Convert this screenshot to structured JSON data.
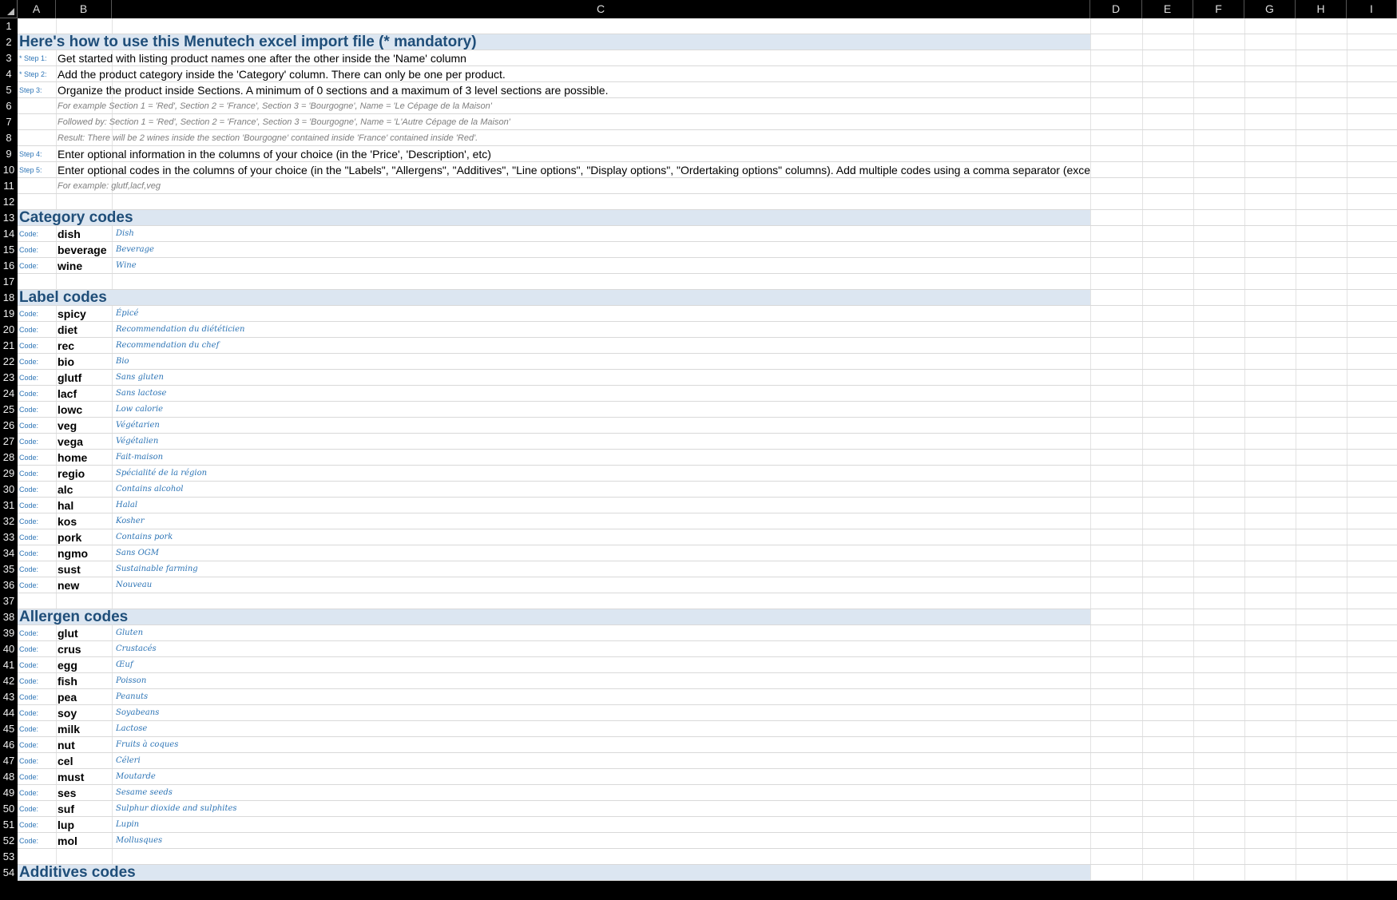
{
  "columns": [
    "A",
    "B",
    "C",
    "D",
    "E",
    "F",
    "G",
    "H",
    "I"
  ],
  "instructions": {
    "title": "Here's how to use this Menutech excel import file (* mandatory)",
    "steps": [
      {
        "label": "* Step 1:",
        "text": "Get started with listing product names one after the other inside the 'Name' column"
      },
      {
        "label": "* Step 2:",
        "text": "Add the product category inside the 'Category' column. There can only be one per product."
      },
      {
        "label": "Step 3:",
        "text": "Organize the product inside Sections. A minimum of 0 sections and a maximum of 3 level sections are possible."
      },
      {
        "label": "",
        "example": "For example Section 1 =  'Red',  Section 2 = 'France', Section 3 = 'Bourgogne', Name = 'Le Cépage de la Maison'"
      },
      {
        "label": "",
        "example": "Followed by: Section 1 =  'Red',  Section 2 = 'France', Section 3 = 'Bourgogne', Name = 'L'Autre Cépage de la Maison'"
      },
      {
        "label": "",
        "example": "Result: There will be 2 wines inside the section 'Bourgogne' contained inside 'France' contained inside 'Red'."
      },
      {
        "label": "Step 4:",
        "text": "Enter optional information in the columns of your choice (in the 'Price', 'Description', etc)"
      },
      {
        "label": "Step 5:",
        "text": "Enter optional codes in the columns of your choice (in the \"Labels\", \"Allergens\", \"Additives\", \"Line options\", \"Display options\", \"Ordertaking options\" columns). Add multiple codes using a comma separator (exce"
      },
      {
        "label": "",
        "example": "For example: glutf,lacf,veg"
      }
    ]
  },
  "code_prefix": "Code:",
  "sections": [
    {
      "title": "Category codes",
      "items": [
        {
          "code": "dish",
          "desc": "Dish"
        },
        {
          "code": "beverage",
          "desc": "Beverage"
        },
        {
          "code": "wine",
          "desc": "Wine"
        }
      ]
    },
    {
      "title": "Label codes",
      "items": [
        {
          "code": "spicy",
          "desc": "Épicé"
        },
        {
          "code": "diet",
          "desc": "Recommendation du diététicien"
        },
        {
          "code": "rec",
          "desc": "Recommendation du chef"
        },
        {
          "code": "bio",
          "desc": "Bio"
        },
        {
          "code": "glutf",
          "desc": "Sans gluten"
        },
        {
          "code": "lacf",
          "desc": "Sans lactose"
        },
        {
          "code": "lowc",
          "desc": "Low calorie"
        },
        {
          "code": "veg",
          "desc": "Végétarien"
        },
        {
          "code": "vega",
          "desc": "Végétalien"
        },
        {
          "code": "home",
          "desc": "Fait-maison"
        },
        {
          "code": "regio",
          "desc": "Spécialité de la région"
        },
        {
          "code": "alc",
          "desc": "Contains alcohol"
        },
        {
          "code": "hal",
          "desc": "Halal"
        },
        {
          "code": "kos",
          "desc": "Kosher"
        },
        {
          "code": "pork",
          "desc": "Contains pork"
        },
        {
          "code": "ngmo",
          "desc": "Sans OGM"
        },
        {
          "code": "sust",
          "desc": "Sustainable farming"
        },
        {
          "code": "new",
          "desc": "Nouveau"
        }
      ]
    },
    {
      "title": "Allergen codes",
      "items": [
        {
          "code": "glut",
          "desc": "Gluten"
        },
        {
          "code": "crus",
          "desc": "Crustacés"
        },
        {
          "code": "egg",
          "desc": "Œuf"
        },
        {
          "code": "fish",
          "desc": "Poisson"
        },
        {
          "code": "pea",
          "desc": "Peanuts"
        },
        {
          "code": "soy",
          "desc": "Soyabeans"
        },
        {
          "code": "milk",
          "desc": "Lactose"
        },
        {
          "code": "nut",
          "desc": "Fruits à coques"
        },
        {
          "code": "cel",
          "desc": "Céleri"
        },
        {
          "code": "must",
          "desc": "Moutarde"
        },
        {
          "code": "ses",
          "desc": "Sesame seeds"
        },
        {
          "code": "suf",
          "desc": "Sulphur dioxide and sulphites"
        },
        {
          "code": "lup",
          "desc": "Lupin"
        },
        {
          "code": "mol",
          "desc": "Mollusques"
        }
      ]
    },
    {
      "title": "Additives codes",
      "items": []
    }
  ]
}
